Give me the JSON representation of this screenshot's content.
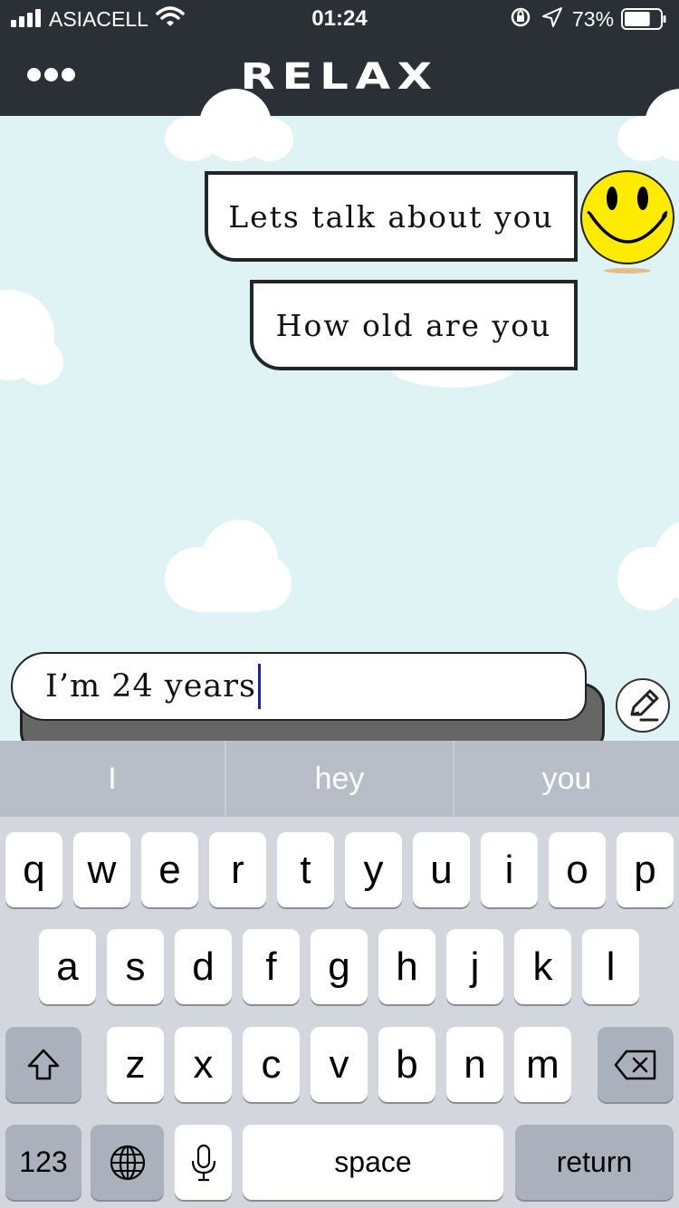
{
  "status_bar": {
    "carrier": "ASIACELL",
    "time": "01:24",
    "battery_percent": "73%",
    "battery_level": 0.73,
    "icons": [
      "signal-icon",
      "wifi-icon",
      "rotation-lock-icon",
      "location-arrow-icon",
      "battery-icon"
    ]
  },
  "header": {
    "title": "RELAX",
    "menu_icon": "more-dots-icon"
  },
  "chat": {
    "messages": [
      {
        "text": "Lets talk about you",
        "sender": "bot"
      },
      {
        "text": "How old are you",
        "sender": "bot"
      }
    ],
    "avatar_icon": "smiley-face-icon"
  },
  "input": {
    "value": "I’m 24 years",
    "edit_icon": "pencil-icon"
  },
  "keyboard": {
    "suggestions": [
      "I",
      "hey",
      "you"
    ],
    "rows": [
      [
        "q",
        "w",
        "e",
        "r",
        "t",
        "y",
        "u",
        "i",
        "o",
        "p"
      ],
      [
        "a",
        "s",
        "d",
        "f",
        "g",
        "h",
        "j",
        "k",
        "l"
      ],
      [
        "z",
        "x",
        "c",
        "v",
        "b",
        "n",
        "m"
      ]
    ],
    "numbers_label": "123",
    "space_label": "space",
    "return_label": "return",
    "icons": [
      "shift-icon",
      "backspace-icon",
      "globe-icon",
      "microphone-icon"
    ]
  },
  "colors": {
    "header_bg": "#2b2f36",
    "chat_bg": "#dff3f4",
    "bubble_border": "#222629",
    "caret": "#1a1ad0",
    "keyboard_bg": "#d3d6dc"
  }
}
